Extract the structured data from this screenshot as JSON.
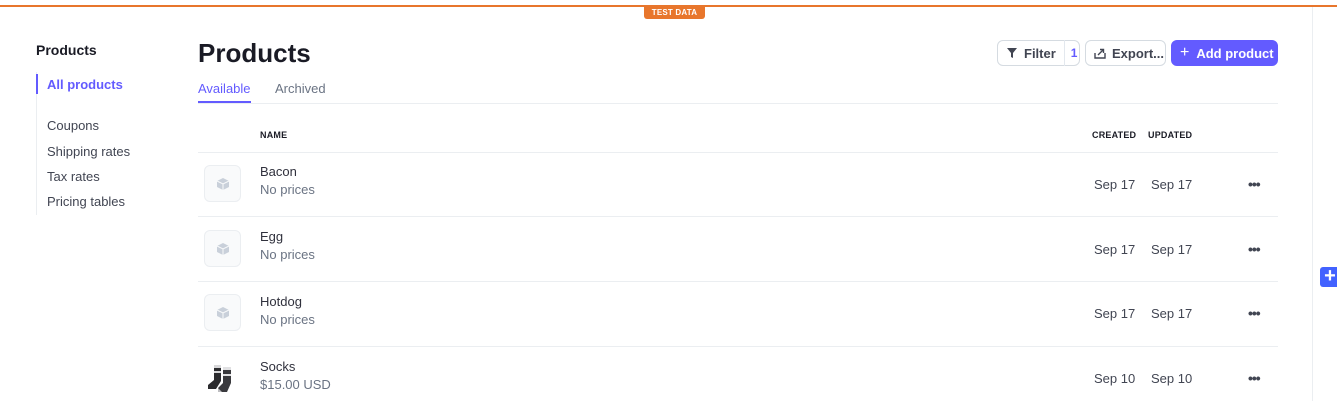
{
  "test_badge": "TEST DATA",
  "sidebar": {
    "title": "Products",
    "items": [
      {
        "label": "All products"
      },
      {
        "label": "Coupons"
      },
      {
        "label": "Shipping rates"
      },
      {
        "label": "Tax rates"
      },
      {
        "label": "Pricing tables"
      }
    ]
  },
  "header": {
    "title": "Products",
    "filter_label": "Filter",
    "filter_count": "1",
    "export_label": "Export...",
    "add_label": "Add product",
    "add_icon": "+"
  },
  "tabs": [
    {
      "label": "Available",
      "active": true
    },
    {
      "label": "Archived",
      "active": false
    }
  ],
  "table": {
    "columns": {
      "name": "NAME",
      "created": "CREATED",
      "updated": "UPDATED"
    },
    "rows": [
      {
        "name": "Bacon",
        "price": "No prices",
        "created": "Sep 17",
        "updated": "Sep 17",
        "image": "box-icon"
      },
      {
        "name": "Egg",
        "price": "No prices",
        "created": "Sep 17",
        "updated": "Sep 17",
        "image": "box-icon"
      },
      {
        "name": "Hotdog",
        "price": "No prices",
        "created": "Sep 17",
        "updated": "Sep 17",
        "image": "box-icon"
      },
      {
        "name": "Socks",
        "price": "$15.00 USD",
        "created": "Sep 10",
        "updated": "Sep 10",
        "image": "socks-photo"
      }
    ],
    "more_label": "•••"
  },
  "float_button": "+",
  "colors": {
    "accent": "#635bff",
    "test_orange": "#e8762c",
    "assistant_blue": "#4262ff"
  }
}
